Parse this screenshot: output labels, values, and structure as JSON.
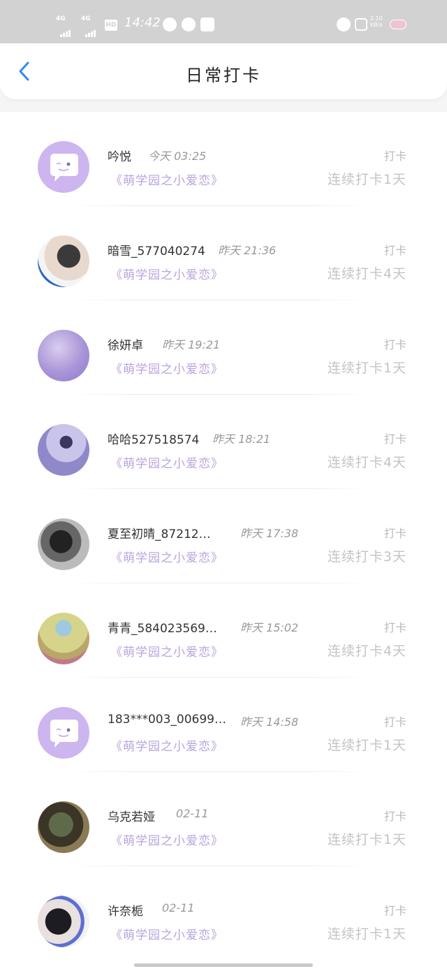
{
  "status_bar": {
    "signal1": "4G",
    "signal2": "4G",
    "hd": "HD",
    "time": "14:42",
    "speed": "2.10 KB/s"
  },
  "header": {
    "title": "日常打卡"
  },
  "entries": [
    {
      "name": "吟悦",
      "time": "今天 03:25",
      "book": "《萌学园之小爱恋》",
      "action": "打卡",
      "streak": "连续打卡1天",
      "avatar": "default-chat-icon"
    },
    {
      "name": "暗雪_577040274",
      "time": "昨天 21:36",
      "book": "《萌学园之小爱恋》",
      "action": "打卡",
      "streak": "连续打卡4天",
      "avatar": "photo"
    },
    {
      "name": "徐妍卓",
      "time": "昨天 19:21",
      "book": "《萌学园之小爱恋》",
      "action": "打卡",
      "streak": "连续打卡1天",
      "avatar": "photo"
    },
    {
      "name": "哈哈527518574",
      "time": "昨天 18:21",
      "book": "《萌学园之小爱恋》",
      "action": "打卡",
      "streak": "连续打卡4天",
      "avatar": "photo"
    },
    {
      "name": "夏至初晴_87212…",
      "time": "昨天 17:38",
      "book": "《萌学园之小爱恋》",
      "action": "打卡",
      "streak": "连续打卡3天",
      "avatar": "photo"
    },
    {
      "name": "青青_584023569…",
      "time": "昨天 15:02",
      "book": "《萌学园之小爱恋》",
      "action": "打卡",
      "streak": "连续打卡4天",
      "avatar": "photo"
    },
    {
      "name": "183***003_00699…",
      "time": "昨天 14:58",
      "book": "《萌学园之小爱恋》",
      "action": "打卡",
      "streak": "连续打卡1天",
      "avatar": "default-chat-icon"
    },
    {
      "name": "乌克若娅",
      "time": "02-11",
      "book": "《萌学园之小爱恋》",
      "action": "打卡",
      "streak": "连续打卡1天",
      "avatar": "photo"
    },
    {
      "name": "许奈栀",
      "time": "02-11",
      "book": "《萌学园之小爱恋》",
      "action": "打卡",
      "streak": "连续打卡1天",
      "avatar": "photo"
    }
  ],
  "colors": {
    "accent": "#2b8cf3",
    "book_text": "#b9a3dd",
    "default_avatar": "#cdb5f0"
  }
}
